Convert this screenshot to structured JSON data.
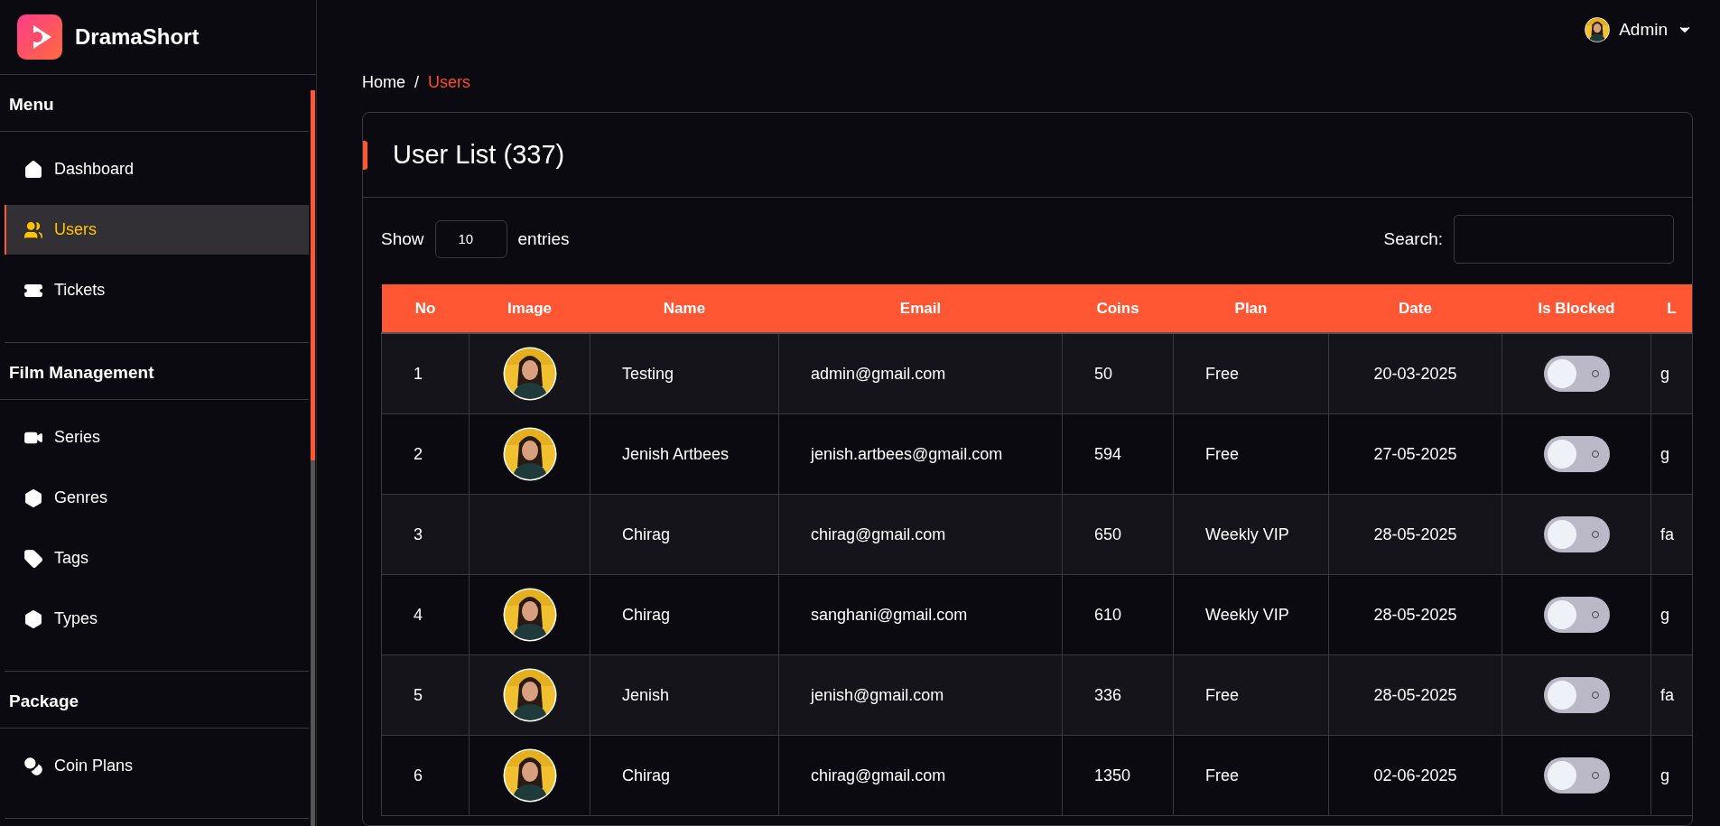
{
  "brand": "DramaShort",
  "user": {
    "name": "Admin"
  },
  "sidebar": {
    "sections": [
      {
        "title": "Menu",
        "items": [
          {
            "label": "Dashboard",
            "selected": false
          },
          {
            "label": "Users",
            "selected": true
          },
          {
            "label": "Tickets",
            "selected": false
          }
        ]
      },
      {
        "title": "Film Management",
        "items": [
          {
            "label": "Series",
            "selected": false
          },
          {
            "label": "Genres",
            "selected": false
          },
          {
            "label": "Tags",
            "selected": false
          },
          {
            "label": "Types",
            "selected": false
          }
        ]
      },
      {
        "title": "Package",
        "items": [
          {
            "label": "Coin Plans",
            "selected": false
          }
        ]
      }
    ]
  },
  "breadcrumb": {
    "separator": "/",
    "items": [
      {
        "label": "Home",
        "selected": false
      },
      {
        "label": "Users",
        "selected": true
      }
    ]
  },
  "card": {
    "title": "User List (337)",
    "show_entries": {
      "before": "Show",
      "value": "10",
      "after": "entries"
    },
    "search": {
      "label": "Search:"
    },
    "table": {
      "columns": [
        "No",
        "Image",
        "Name",
        "Email",
        "Coins",
        "Plan",
        "Date",
        "Is Blocked",
        "L"
      ],
      "rows": [
        {
          "no": "1",
          "has_image": true,
          "name": "Testing",
          "email": "admin@gmail.com",
          "coins": "50",
          "plan": "Free",
          "date": "20-03-2025",
          "blocked": false,
          "column_9": "g"
        },
        {
          "no": "2",
          "has_image": true,
          "name": "Jenish Artbees",
          "email": "jenish.artbees@gmail.com",
          "coins": "594",
          "plan": "Free",
          "date": "27-05-2025",
          "blocked": false,
          "column_9": "g"
        },
        {
          "no": "3",
          "has_image": false,
          "name": "Chirag",
          "email": "chirag@gmail.com",
          "coins": "650",
          "plan": "Weekly VIP",
          "date": "28-05-2025",
          "blocked": false,
          "column_9": "fa"
        },
        {
          "no": "4",
          "has_image": true,
          "name": "Chirag",
          "email": "sanghani@gmail.com",
          "coins": "610",
          "plan": "Weekly VIP",
          "date": "28-05-2025",
          "blocked": false,
          "column_9": "g"
        },
        {
          "no": "5",
          "has_image": true,
          "name": "Jenish",
          "email": "jenish@gmail.com",
          "coins": "336",
          "plan": "Free",
          "date": "28-05-2025",
          "blocked": false,
          "column_9": "fa"
        },
        {
          "no": "6",
          "has_image": true,
          "name": "Chirag",
          "email": "chirag@gmail.com",
          "coins": "1350",
          "plan": "Free",
          "date": "02-06-2025",
          "blocked": false,
          "column_9": "g"
        }
      ]
    }
  }
}
